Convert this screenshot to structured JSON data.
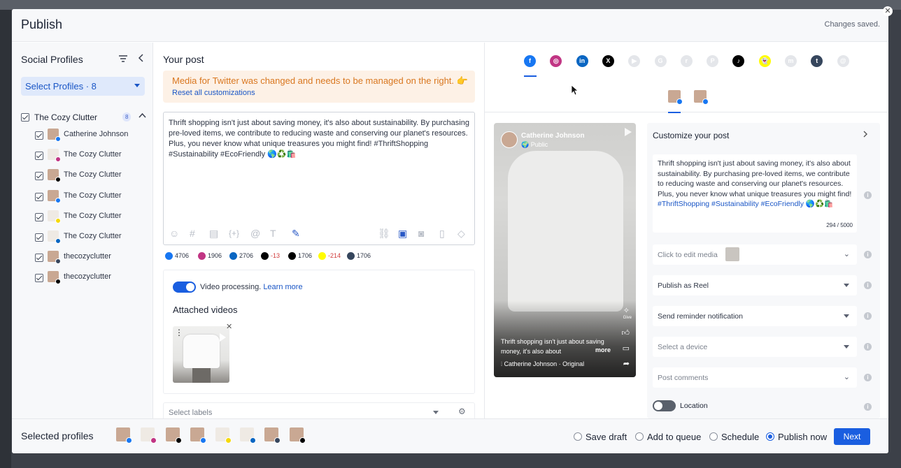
{
  "window": {
    "title": "Publish",
    "status": "Changes saved.",
    "close": "✕"
  },
  "sidebar": {
    "title": "Social Profiles",
    "select_label": "Select Profiles · 8",
    "group": {
      "name": "The Cozy Clutter",
      "count": "8"
    },
    "profiles": [
      {
        "name": "Catherine Johnson",
        "network": "facebook"
      },
      {
        "name": "The Cozy Clutter",
        "network": "instagram"
      },
      {
        "name": "The Cozy Clutter",
        "network": "x"
      },
      {
        "name": "The Cozy Clutter",
        "network": "facebook"
      },
      {
        "name": "The Cozy Clutter",
        "network": "snapchat"
      },
      {
        "name": "The Cozy Clutter",
        "network": "linkedin"
      },
      {
        "name": "thecozyclutter",
        "network": "tumblr"
      },
      {
        "name": "thecozyclutter",
        "network": "tiktok"
      }
    ]
  },
  "post": {
    "title": "Your post",
    "warning": "Media for Twitter was changed and needs to be managed on the right. 👉",
    "reset_link": "Reset all customizations",
    "text": "Thrift shopping isn't just about saving money, it's also about sustainability. By purchasing pre-loved items, we contribute to reducing waste and conserving our planet's resources. Plus, you never know what unique treasures you might find! #ThriftShopping #Sustainability #EcoFriendly 🌎♻️🛍️",
    "counts": [
      {
        "network": "facebook",
        "value": "4706",
        "color": "#1877f2"
      },
      {
        "network": "instagram",
        "value": "1906",
        "color": "#c13584"
      },
      {
        "network": "linkedin",
        "value": "2706",
        "color": "#0a66c2"
      },
      {
        "network": "x",
        "value": "-13",
        "color": "#000000",
        "negative": true
      },
      {
        "network": "tiktok",
        "value": "1706",
        "color": "#000000"
      },
      {
        "network": "snapchat",
        "value": "-214",
        "color": "#fffc00",
        "negative": true
      },
      {
        "network": "tumblr",
        "value": "1706",
        "color": "#36465d"
      }
    ],
    "video_processing": "Video processing.",
    "learn_more": "Learn more",
    "attached_videos": "Attached videos",
    "labels_placeholder": "Select labels"
  },
  "preview": {
    "networks": [
      {
        "name": "facebook",
        "color": "#1877f2",
        "glyph": "f"
      },
      {
        "name": "instagram",
        "color": "#c13584",
        "glyph": "◎"
      },
      {
        "name": "linkedin",
        "color": "#0a66c2",
        "glyph": "in"
      },
      {
        "name": "x",
        "color": "#000000",
        "glyph": "X"
      },
      {
        "name": "youtube",
        "color": "#e4e6ea",
        "glyph": "▶"
      },
      {
        "name": "google-business",
        "color": "#e4e6ea",
        "glyph": "G"
      },
      {
        "name": "reddit",
        "color": "#e4e6ea",
        "glyph": "r"
      },
      {
        "name": "pinterest",
        "color": "#e4e6ea",
        "glyph": "P"
      },
      {
        "name": "tiktok",
        "color": "#000000",
        "glyph": "♪"
      },
      {
        "name": "snapchat",
        "color": "#fffc00",
        "glyph": "👻"
      },
      {
        "name": "mastodon",
        "color": "#e4e6ea",
        "glyph": "m"
      },
      {
        "name": "tumblr",
        "color": "#36465d",
        "glyph": "t"
      },
      {
        "name": "threads",
        "color": "#e4e6ea",
        "glyph": "@"
      }
    ],
    "reel": {
      "author": "Catherine Johnson",
      "visibility": "🌍 Public",
      "caption": "Thrift shopping isn't just about saving money, it's also about",
      "more": "more",
      "audio": "Catherine Johnson · Original",
      "give": "Give"
    }
  },
  "customize": {
    "title": "Customize your post",
    "text_plain": "Thrift shopping isn't just about saving money, it's also about sustainability. By purchasing pre-loved items, we contribute to reducing waste and conserving our planet's resources. Plus, you never know what unique treasures you might find! ",
    "hashtags": "#ThriftShopping #Sustainability #EcoFriendly",
    "emoji": " 🌎♻️🛍️",
    "char_count": "294 / 5000",
    "media_label": "Click to edit media",
    "publish_as": "Publish as Reel",
    "reminder": "Send reminder notification",
    "device": "Select a device",
    "comments": "Post comments",
    "location": "Location"
  },
  "footer": {
    "selected_profiles": "Selected profiles",
    "options": [
      "Save draft",
      "Add to queue",
      "Schedule",
      "Publish now"
    ],
    "selected_option": "Publish now",
    "next": "Next"
  },
  "colors": {
    "accent": "#1a5ee0",
    "warning": "#d9771f",
    "warning_bg": "#fdf1e6",
    "link": "#1a56c6"
  }
}
